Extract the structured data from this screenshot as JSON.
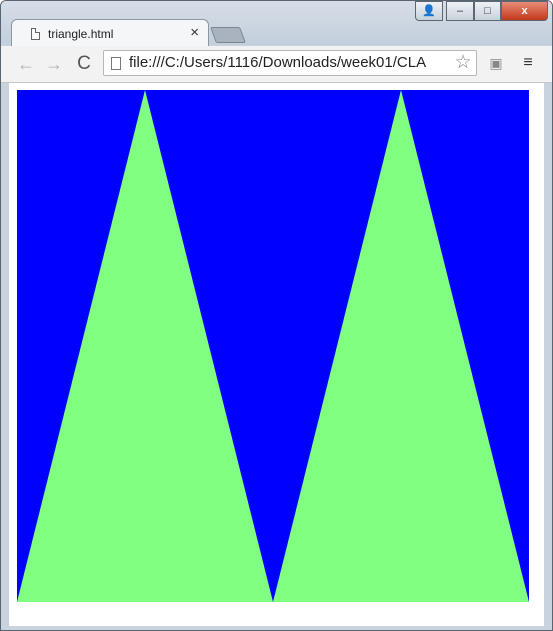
{
  "tab": {
    "title": "triangle.html",
    "close_label": "×"
  },
  "window_buttons": {
    "user": "👤",
    "minimize": "–",
    "maximize": "□",
    "close": "x"
  },
  "toolbar": {
    "back": "←",
    "forward": "→",
    "reload": "C",
    "star": "☆",
    "extension": "▣",
    "menu": "≡"
  },
  "address": {
    "url": "file:///C:/Users/1116/Downloads/week01/CLA"
  },
  "canvas": {
    "background": "#0000ff",
    "triangle_color": "#80ff80"
  }
}
